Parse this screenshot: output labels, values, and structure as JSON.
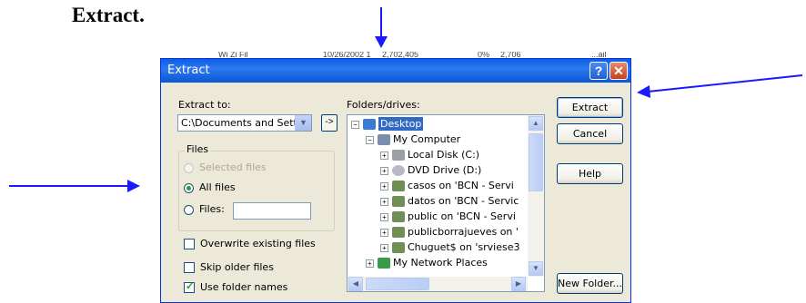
{
  "document": {
    "heading": "Extract."
  },
  "ghost_row": {
    "name": "Wi    Zi    Fil",
    "date": "10/26/2002 1",
    "size": "2,702,405",
    "ratio": "0%",
    "packed": "2,706",
    "attr": "...ail"
  },
  "dialog": {
    "title": "Extract",
    "extract_to_label": "Extract to:",
    "extract_to_value": "C:\\Documents and Settin",
    "browse_label": "->",
    "files_group_title": "Files",
    "radio_selected_files": "Selected files",
    "radio_all_files": "All files",
    "radio_files": "Files:",
    "files_value": "",
    "overwrite_label": "Overwrite existing files",
    "skip_older_label": "Skip older files",
    "use_folder_names_label": "Use folder names",
    "folders_label": "Folders/drives:",
    "tree": [
      {
        "label": "Desktop",
        "icon": "desktop-icon",
        "expander": "−",
        "selected": true
      },
      {
        "label": "My Computer",
        "icon": "computer-icon",
        "expander": "−"
      },
      {
        "label": "Local Disk (C:)",
        "icon": "drive-icon",
        "expander": "+"
      },
      {
        "label": "DVD Drive (D:)",
        "icon": "dvd-icon",
        "expander": "+"
      },
      {
        "label": "casos on 'BCN - Servi",
        "icon": "network-drive-icon",
        "expander": "+"
      },
      {
        "label": "datos on 'BCN - Servic",
        "icon": "network-drive-icon",
        "expander": "+"
      },
      {
        "label": "public on 'BCN - Servi",
        "icon": "network-drive-icon",
        "expander": "+"
      },
      {
        "label": "publicborrajueves on '",
        "icon": "network-drive-icon",
        "expander": "+"
      },
      {
        "label": "Chuguet$ on 'srviese3",
        "icon": "network-drive-icon",
        "expander": "+"
      },
      {
        "label": "My Network Places",
        "icon": "network-places-icon",
        "expander": "+"
      }
    ],
    "buttons": {
      "extract": "Extract",
      "cancel": "Cancel",
      "help": "Help",
      "new_folder": "New Folder..."
    },
    "titlebar_help": "?",
    "titlebar_close": "✕"
  },
  "colors": {
    "titlebar": "#0a5fe6",
    "dialog_bg": "#ece9d8",
    "arrow": "#1a1aff"
  }
}
